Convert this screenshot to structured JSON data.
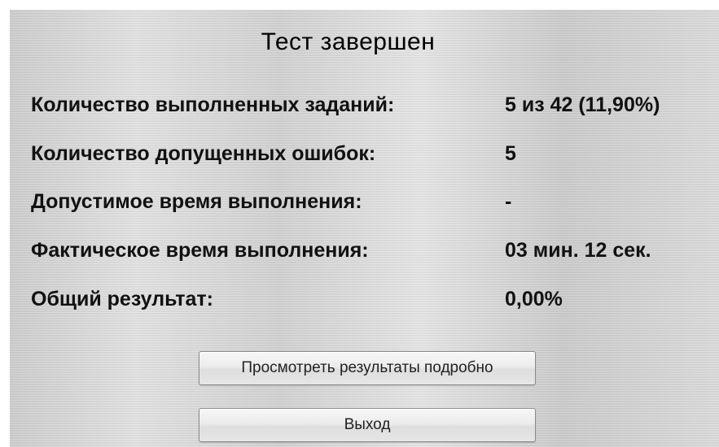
{
  "dialog": {
    "title": "Тест завершен",
    "rows": [
      {
        "label": "Количество выполненных заданий:",
        "value": "5 из 42 (11,90%)"
      },
      {
        "label": "Количество допущенных ошибок:",
        "value": "5"
      },
      {
        "label": "Допустимое время выполнения:",
        "value": "-"
      },
      {
        "label": "Фактическое время выполнения:",
        "value": "03 мин. 12 сек."
      },
      {
        "label": "Общий результат:",
        "value": "0,00%"
      }
    ],
    "buttons": {
      "details_label": "Просмотреть результаты подробно",
      "exit_label": "Выход"
    }
  }
}
